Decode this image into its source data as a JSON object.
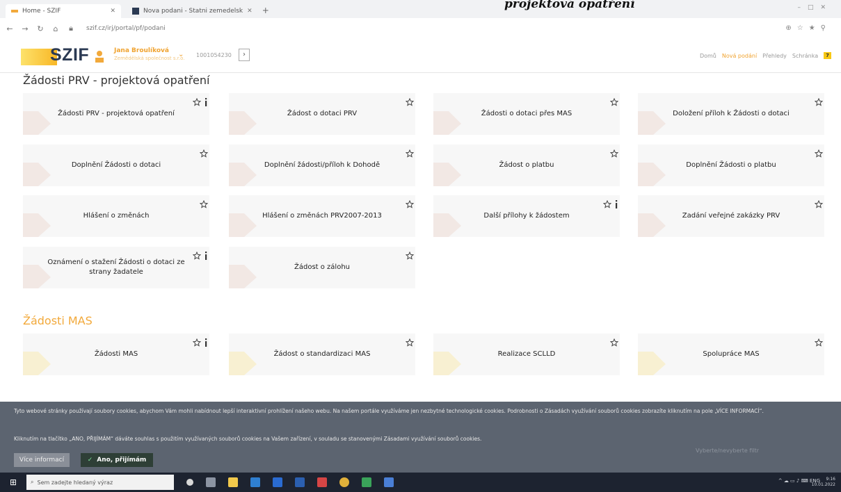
{
  "browser": {
    "tabs": [
      {
        "title": "Home - SZIF",
        "active": true
      },
      {
        "title": "Nova podani - Statni zemedelsk",
        "active": false
      }
    ],
    "new_tab": "+",
    "url": "szif.cz/irj/portal/pf/podani",
    "headline_fragment": "projektová opatření"
  },
  "site": {
    "logo": "SZIF",
    "user": {
      "name": "Jana Broulíková",
      "org": "Zemědělská společnost s.r.o.",
      "id": "1001054230"
    },
    "nav": {
      "home": "Domů",
      "new": "Nová podání",
      "overview": "Přehledy",
      "inbox": "Schránka",
      "inbox_count": "7"
    }
  },
  "sections": [
    {
      "title": "Žádosti PRV - projektová opatření",
      "tiles": [
        {
          "label": "Žádosti PRV - projektová opatření",
          "info": true
        },
        {
          "label": "Žádost o dotaci PRV",
          "info": false
        },
        {
          "label": "Žádosti o dotaci přes MAS",
          "info": false
        },
        {
          "label": "Doložení příloh k Žádosti o dotaci",
          "info": false
        },
        {
          "label": "Doplnění Žádosti o dotaci",
          "info": false
        },
        {
          "label": "Doplnění žádosti/příloh k Dohodě",
          "info": false
        },
        {
          "label": "Žádost o platbu",
          "info": false
        },
        {
          "label": "Doplnění Žádosti o platbu",
          "info": false
        },
        {
          "label": "Hlášení o změnách",
          "info": false
        },
        {
          "label": "Hlášení o změnách PRV2007-2013",
          "info": false
        },
        {
          "label": "Další přílohy k žádostem",
          "info": true
        },
        {
          "label": "Zadání veřejné zakázky PRV",
          "info": false
        },
        {
          "label": "Oznámení o stažení Žádosti o dotaci ze strany žadatele",
          "info": true
        },
        {
          "label": "Žádost o zálohu",
          "info": false
        }
      ]
    },
    {
      "title": "Žádosti MAS",
      "tiles": [
        {
          "label": "Žádosti MAS",
          "info": true
        },
        {
          "label": "Žádost o standardizaci MAS",
          "info": false
        },
        {
          "label": "Realizace SCLLD",
          "info": false
        },
        {
          "label": "Spolupráce MAS",
          "info": false
        }
      ]
    }
  ],
  "cookie_bar": {
    "text1": "Tyto webové stránky používají soubory cookies, abychom Vám mohli nabídnout lepší interaktivní prohlížení našeho webu. Na našem portále využíváme jen nezbytné technologické cookies. Podrobnosti o Zásadách využívání souborů cookies zobrazíte kliknutím na pole „VÍCE INFORMACÍ“.",
    "text2": "Kliknutím na tlačítko „ANO, PŘIJÍMÁM“ dáváte souhlas s použitím využívaných souborů cookies na Vašem zařízení, v souladu se stanovenými Zásadami využívání souborů cookies.",
    "more_label": "Více informací",
    "accept_label": "Ano, přijímám",
    "ghost_text": "Vyberte/nevyberte filtr"
  },
  "taskbar": {
    "search_placeholder": "Sem zadejte hledaný výraz",
    "time": "9:16",
    "date": "10.01.2022"
  },
  "colors": {
    "accent": "#f2a93b",
    "navy": "#2b3a53",
    "cookie_bg": "#5c6470",
    "accept_bg": "#2e3f36"
  }
}
